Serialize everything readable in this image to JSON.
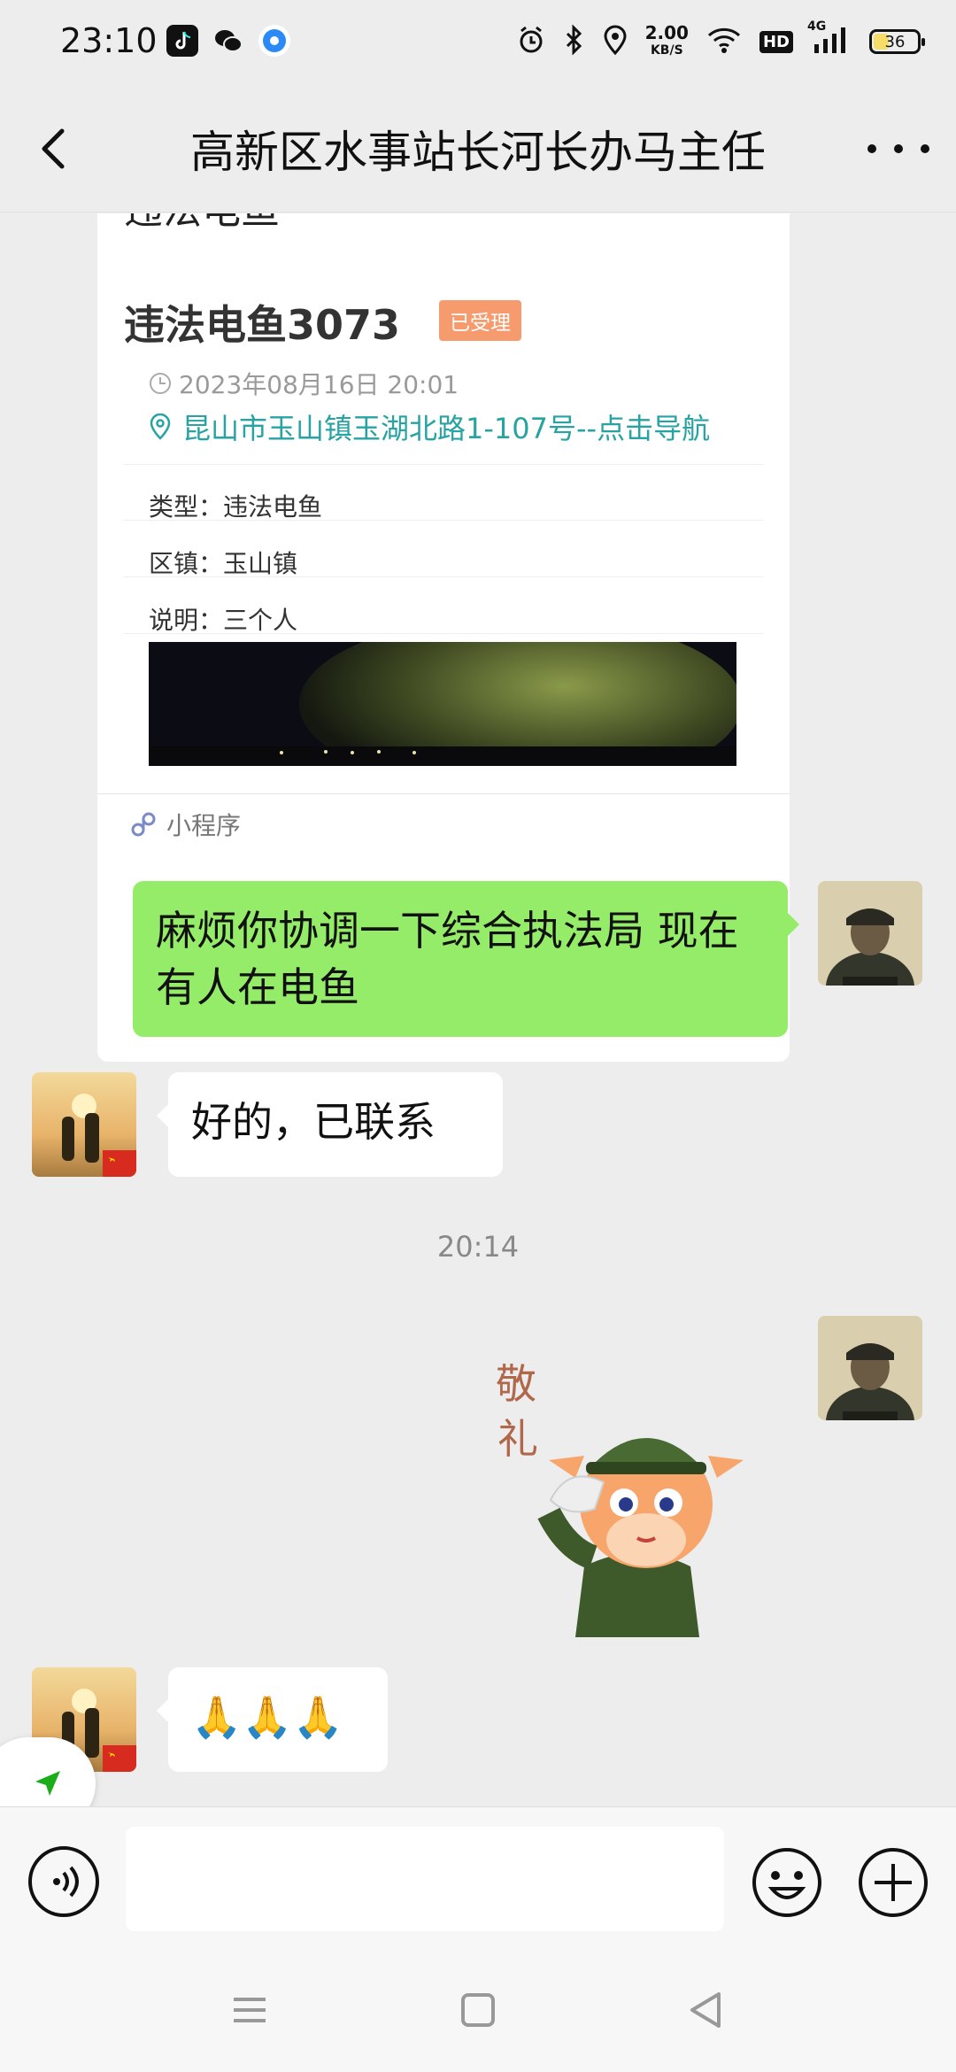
{
  "status_bar": {
    "time": "23:10",
    "apps": [
      "tiktok-icon",
      "wechat-icon",
      "browser-icon"
    ],
    "network_speed": "2.00",
    "network_speed_unit": "KB/S",
    "hd_label": "HD",
    "network_type": "4G",
    "battery_level": "36",
    "battery_fraction": 0.36,
    "icons": [
      "alarm-icon",
      "bluetooth-icon",
      "location-icon",
      "wifi-icon",
      "signal-icon"
    ]
  },
  "header": {
    "title": "高新区水事站长河长办马主任"
  },
  "card": {
    "cut_off_heading": "违法电鱼",
    "case_title": "违法电鱼3073",
    "status_badge": "已受理",
    "time": "2023年08月16日 20:01",
    "address": "昆山市玉山镇玉湖北路1-107号--点击导航",
    "fields": [
      {
        "label": "类型：",
        "value": "违法电鱼"
      },
      {
        "label": "区镇：",
        "value": "玉山镇"
      },
      {
        "label": "说明：",
        "value": "三个人"
      }
    ],
    "footer_label": "小程序"
  },
  "messages": [
    {
      "from": "me",
      "text": "麻烦你协调一下综合执法局 现在有人在电鱼"
    },
    {
      "from": "other",
      "text": "好的，已联系"
    },
    {
      "from": "me",
      "type": "sticker",
      "sticker_text": "敬礼"
    },
    {
      "from": "other",
      "text": "🙏🙏🙏"
    }
  ],
  "timestamp": "20:14",
  "input_bar": {
    "value": "",
    "placeholder": ""
  },
  "colors": {
    "my_bubble": "#95ec69",
    "other_bubble": "#ffffff",
    "background": "#ededed",
    "badge": "#f59b6e",
    "link": "#27a3a3"
  }
}
